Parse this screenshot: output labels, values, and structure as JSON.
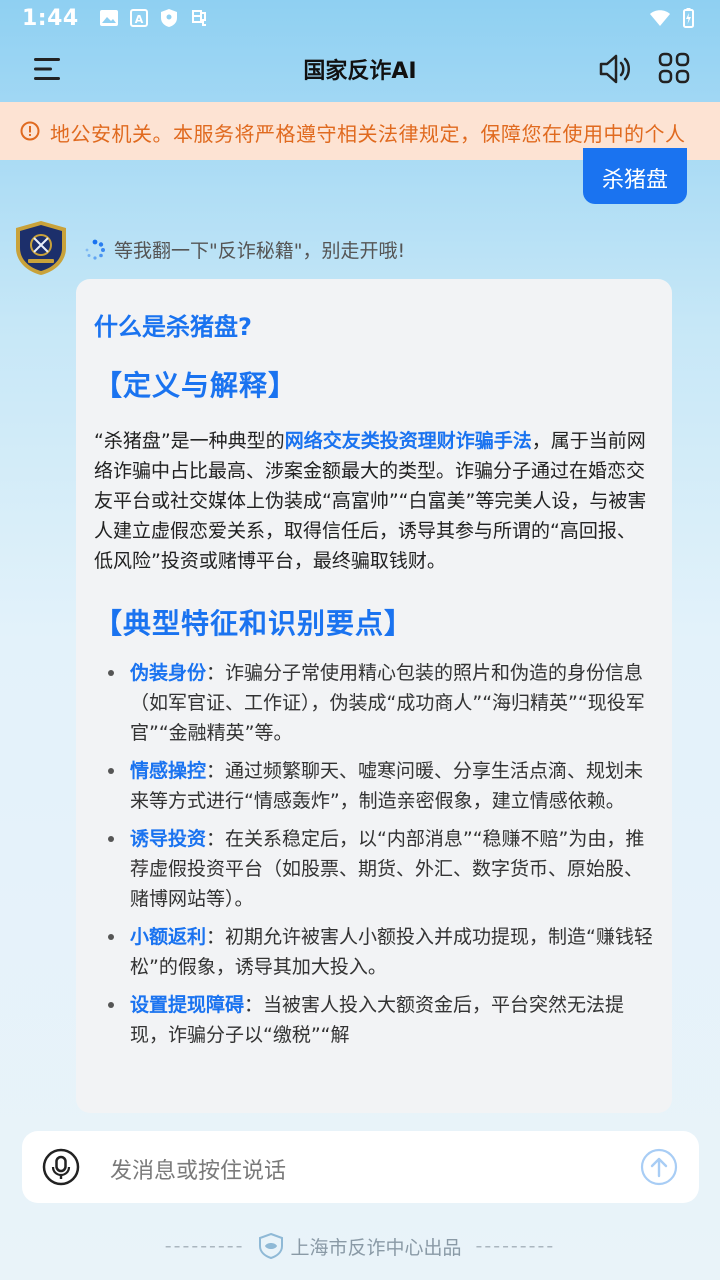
{
  "status": {
    "time": "1:44"
  },
  "appbar": {
    "title": "国家反诈AI"
  },
  "notice": {
    "text": "地公安机关。本服务将严格遵守相关法律规定，保障您在使用中的个人"
  },
  "user_message": "杀猪盘",
  "thinking": "等我翻一下\"反诈秘籍\"，别走开哦!",
  "answer": {
    "heading": "什么是杀猪盘?",
    "sec1_title": "【定义与解释】",
    "para_part1": "“杀猪盘”是一种典型的",
    "para_highlight": "网络交友类投资理财诈骗手法",
    "para_part2": "，属于当前网络诈骗中占比最高、涉案金额最大的类型。诈骗分子通过在婚恋交友平台或社交媒体上伪装成“高富帅”“白富美”等完美人设，与被害人建立虚假恋爱关系，取得信任后，诱导其参与所谓的“高回报、低风险”投资或赌博平台，最终骗取钱财。",
    "sec2_title": "【典型特征和识别要点】",
    "features": [
      {
        "term": "伪装身份",
        "desc": "：诈骗分子常使用精心包装的照片和伪造的身份信息（如军官证、工作证），伪装成“成功商人”“海归精英”“现役军官”“金融精英”等。"
      },
      {
        "term": "情感操控",
        "desc": "：通过频繁聊天、嘘寒问暖、分享生活点滴、规划未来等方式进行“情感轰炸”，制造亲密假象，建立情感依赖。"
      },
      {
        "term": "诱导投资",
        "desc": "：在关系稳定后，以“内部消息”“稳赚不赔”为由，推荐虚假投资平台（如股票、期货、外汇、数字货币、原始股、赌博网站等）。"
      },
      {
        "term": "小额返利",
        "desc": "：初期允许被害人小额投入并成功提现，制造“赚钱轻松”的假象，诱导其加大投入。"
      },
      {
        "term": "设置提现障碍",
        "desc": "：当被害人投入大额资金后，平台突然无法提现，诈骗分子以“缴税”“解"
      }
    ]
  },
  "input": {
    "placeholder": "发消息或按住说话"
  },
  "footer": {
    "dashes_left": "---------",
    "text": "上海市反诈中心出品",
    "dashes_right": "---------"
  },
  "colors": {
    "accent": "#1a73f0",
    "notice_bg": "#fde3d3",
    "notice_text": "#e06a1f"
  }
}
